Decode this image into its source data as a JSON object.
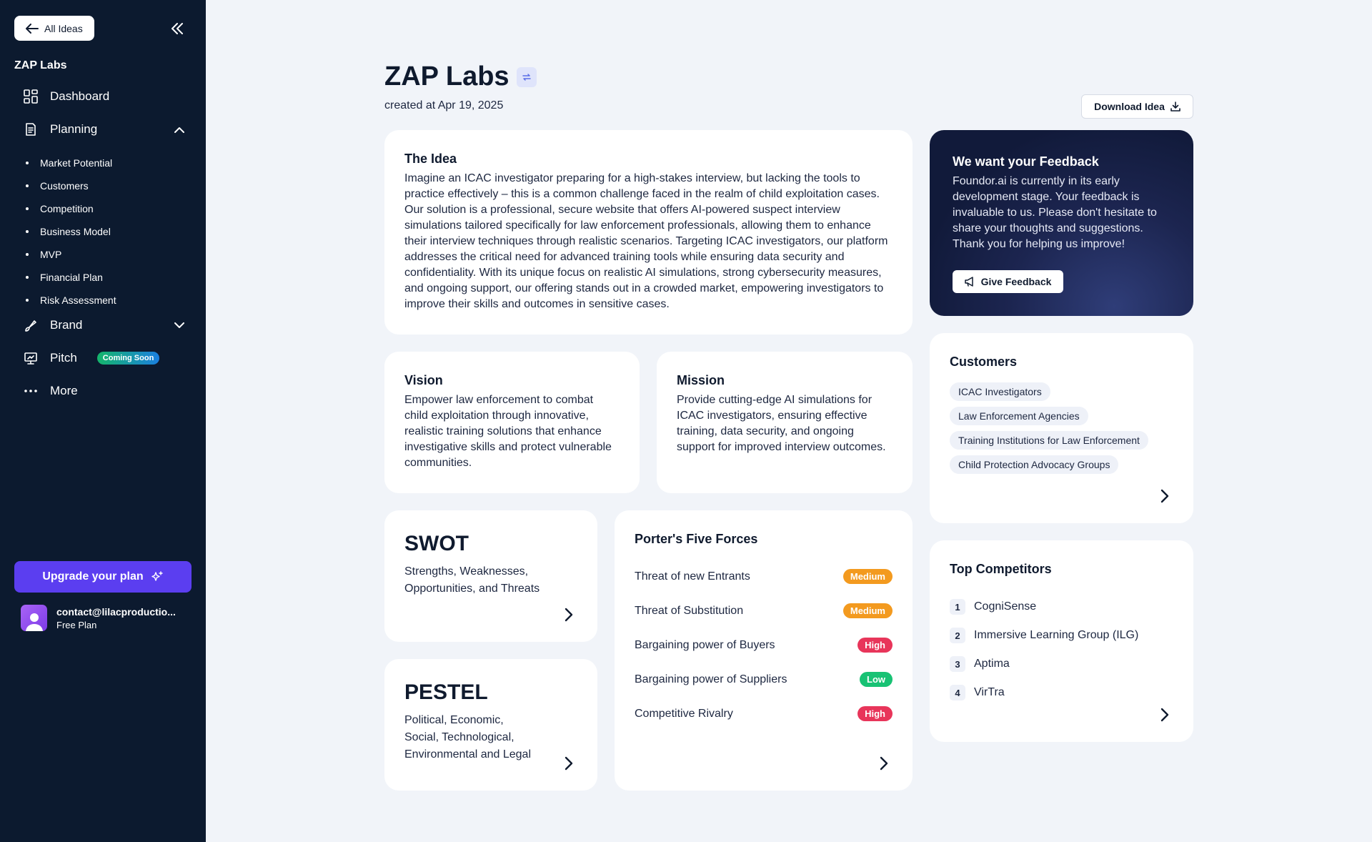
{
  "sidebar": {
    "back_label": "All Ideas",
    "workspace": "ZAP Labs",
    "nav": {
      "dashboard": "Dashboard",
      "planning": "Planning",
      "brand": "Brand",
      "pitch": "Pitch",
      "pitch_badge": "Coming Soon",
      "more": "More"
    },
    "planning_items": [
      "Market Potential",
      "Customers",
      "Competition",
      "Business Model",
      "MVP",
      "Financial Plan",
      "Risk Assessment"
    ],
    "upgrade_label": "Upgrade your plan",
    "user": {
      "email": "contact@lilacproductio...",
      "plan": "Free Plan"
    }
  },
  "header": {
    "title": "ZAP Labs",
    "created": "created at Apr 19, 2025",
    "download_label": "Download Idea"
  },
  "idea": {
    "title": "The Idea",
    "text": "Imagine an ICAC investigator preparing for a high-stakes interview, but lacking the tools to practice effectively – this is a common challenge faced in the realm of child exploitation cases. Our solution is a professional, secure website that offers AI-powered suspect interview simulations tailored specifically for law enforcement professionals, allowing them to enhance their interview techniques through realistic scenarios. Targeting ICAC investigators, our platform addresses the critical need for advanced training tools while ensuring data security and confidentiality. With its unique focus on realistic AI simulations, strong cybersecurity measures, and ongoing support, our offering stands out in a crowded market, empowering investigators to improve their skills and outcomes in sensitive cases."
  },
  "vision": {
    "title": "Vision",
    "text": "Empower law enforcement to combat child exploitation through innovative, realistic training solutions that enhance investigative skills and protect vulnerable communities."
  },
  "mission": {
    "title": "Mission",
    "text": "Provide cutting-edge AI simulations for ICAC investigators, ensuring effective training, data security, and ongoing support for improved interview outcomes."
  },
  "swot": {
    "title": "SWOT",
    "text": "Strengths, Weaknesses, Opportunities, and Threats"
  },
  "pestel": {
    "title": "PESTEL",
    "text": "Political, Economic, Social, Technological, Environmental and Legal"
  },
  "porter": {
    "title": "Porter's Five Forces",
    "forces": [
      {
        "label": "Threat of new Entrants",
        "level": "Medium"
      },
      {
        "label": "Threat of Substitution",
        "level": "Medium"
      },
      {
        "label": "Bargaining power of Buyers",
        "level": "High"
      },
      {
        "label": "Bargaining power of Suppliers",
        "level": "Low"
      },
      {
        "label": "Competitive Rivalry",
        "level": "High"
      }
    ]
  },
  "feedback": {
    "title": "We want your Feedback",
    "text": "Foundor.ai is currently in its early development stage. Your feedback is invaluable to us. Please don't hesitate to share your thoughts and suggestions. Thank you for helping us improve!",
    "button": "Give Feedback"
  },
  "customers": {
    "title": "Customers",
    "tags": [
      "ICAC Investigators",
      "Law Enforcement Agencies",
      "Training Institutions for Law Enforcement",
      "Child Protection Advocacy Groups"
    ]
  },
  "competitors": {
    "title": "Top Competitors",
    "items": [
      {
        "num": "1",
        "name": "CogniSense"
      },
      {
        "num": "2",
        "name": "Immersive Learning Group (ILG)"
      },
      {
        "num": "3",
        "name": "Aptima"
      },
      {
        "num": "4",
        "name": "VirTra"
      }
    ]
  },
  "colors": {
    "sidebar": "#0c1a2f",
    "accent": "#5b3ef0",
    "medium": "#f39a1f",
    "high": "#e8355a",
    "low": "#18c274"
  }
}
